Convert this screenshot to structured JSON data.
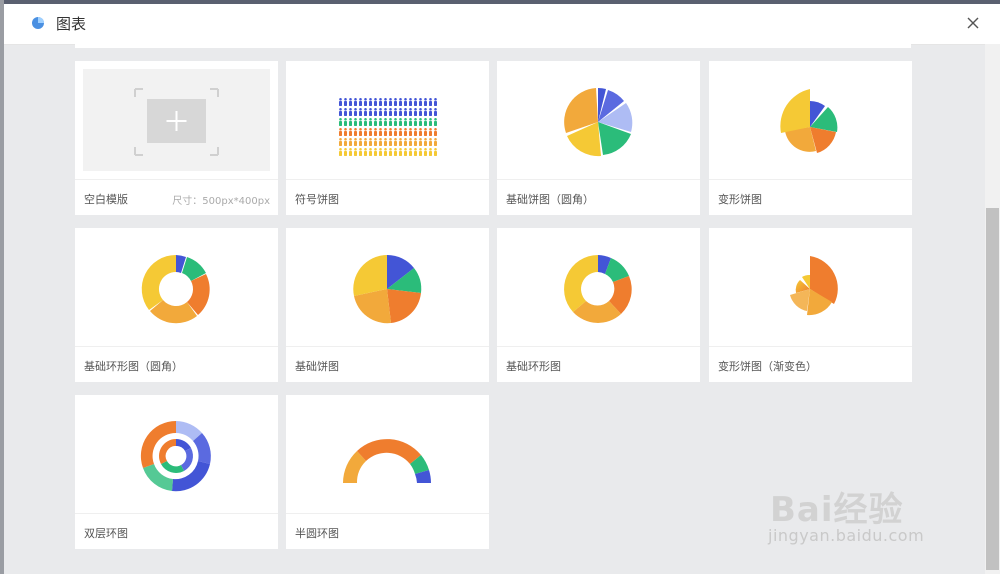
{
  "dialog": {
    "title": "图表"
  },
  "cards": [
    {
      "label": "空白模版",
      "size": "尺寸：500px*400px"
    },
    {
      "label": "符号饼图"
    },
    {
      "label": "基础饼图（圆角）"
    },
    {
      "label": "变形饼图"
    },
    {
      "label": "基础环形图（圆角）"
    },
    {
      "label": "基础饼图"
    },
    {
      "label": "基础环形图"
    },
    {
      "label": "变形饼图（渐变色）"
    },
    {
      "label": "双层环图"
    },
    {
      "label": "半圆环图"
    }
  ],
  "colors": {
    "blue": "#4355d6",
    "green": "#2bbc7a",
    "orange": "#ef7d2e",
    "amber": "#f2a93b",
    "yellow": "#f5c935",
    "lightblue": "#aebcf4",
    "darkorange": "#eb6f29"
  },
  "watermark": {
    "brand": "Bai经验",
    "url": "jingyan.baidu.com"
  }
}
